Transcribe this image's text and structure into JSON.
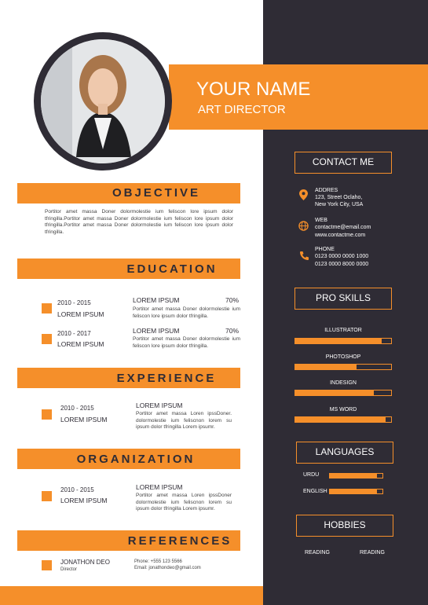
{
  "header": {
    "name": "YOUR NAME",
    "title": "ART DIRECTOR"
  },
  "sections": {
    "objective": "OBJECTIVE",
    "education": "EDUCATION",
    "experience": "EXPERIENCE",
    "organization": "ORGANIZATION",
    "references": "REFERENCES"
  },
  "objective_text": "Portitor amet massa Doner dolormolestie ium feliscon lore ipsum dolor tfringilla.Portitor amet massa Doner dolormolestie ium feliscon lore ipsum dolor tfringilla.Portitor amet massa Doner dolormolestie ium feliscon lore ipsum dolor tfringilla.",
  "education": [
    {
      "date": "2010 - 2015",
      "place": "LOREM IPSUM",
      "title": "LOREM IPSUM",
      "percent": "70%",
      "desc": "Portitor amet massa Doner dolormolestie ium feliscon lore ipsum dolor tfringilla."
    },
    {
      "date": "2010 - 2017",
      "place": "LOREM IPSUM",
      "title": "LOREM IPSUM",
      "percent": "70%",
      "desc": "Portitor amet massa Doner dolormolestie ium feliscon lore ipsum dolor tfringilla."
    }
  ],
  "experience": {
    "date": "2010 - 2015",
    "place": "LOREM IPSUM",
    "title": "LOREM IPSUM",
    "desc": "Portitor amet massa Loren ipssDoner. dolormolestie ium feliscnon lorem su ipsum dolor tfringilla Lorem ipsumr."
  },
  "organization": {
    "date": "2010 - 2015",
    "place": "LOREM IPSUM",
    "title": "LOREM IPSUM",
    "desc": "Portitor amet massa Loren ipssDoner dolormolestie ium feliscnon lorem su ipsum dolor tfringilla Lorem ipsumr."
  },
  "reference": {
    "name": "JONATHON DEO",
    "role": "Director",
    "phone": "Phone: +555 123 5566",
    "email": "Email: jonathondeo@gmail.com"
  },
  "contact": {
    "heading": "CONTACT ME",
    "address_label": "ADDRES",
    "address_line1": "123, Street Oclaho,",
    "address_line2": "New York City, USA",
    "web_label": "WEB",
    "web_line1": "contactme@email.com",
    "web_line2": "www.contactme.com",
    "phone_label": "PHONE",
    "phone_line1": "0123 0000 0000 1000",
    "phone_line2": "0123 0000 8000 0000"
  },
  "pro_skills": {
    "heading": "PRO SKILLS",
    "items": [
      {
        "name": "ILLUSTRATOR",
        "level": 0.9
      },
      {
        "name": "PHOTOSHOP",
        "level": 0.64
      },
      {
        "name": "INDESIGN",
        "level": 0.82
      },
      {
        "name": "MS WORD",
        "level": 0.94
      }
    ]
  },
  "languages": {
    "heading": "LANGUAGES",
    "items": [
      {
        "name": "URDU",
        "level": 0.9
      },
      {
        "name": "ENGLISH",
        "level": 0.9
      }
    ]
  },
  "hobbies": {
    "heading": "HOBBIES",
    "items": [
      "READING",
      "READING"
    ]
  },
  "colors": {
    "accent": "#f58f2a",
    "dark": "#2f2c35"
  }
}
